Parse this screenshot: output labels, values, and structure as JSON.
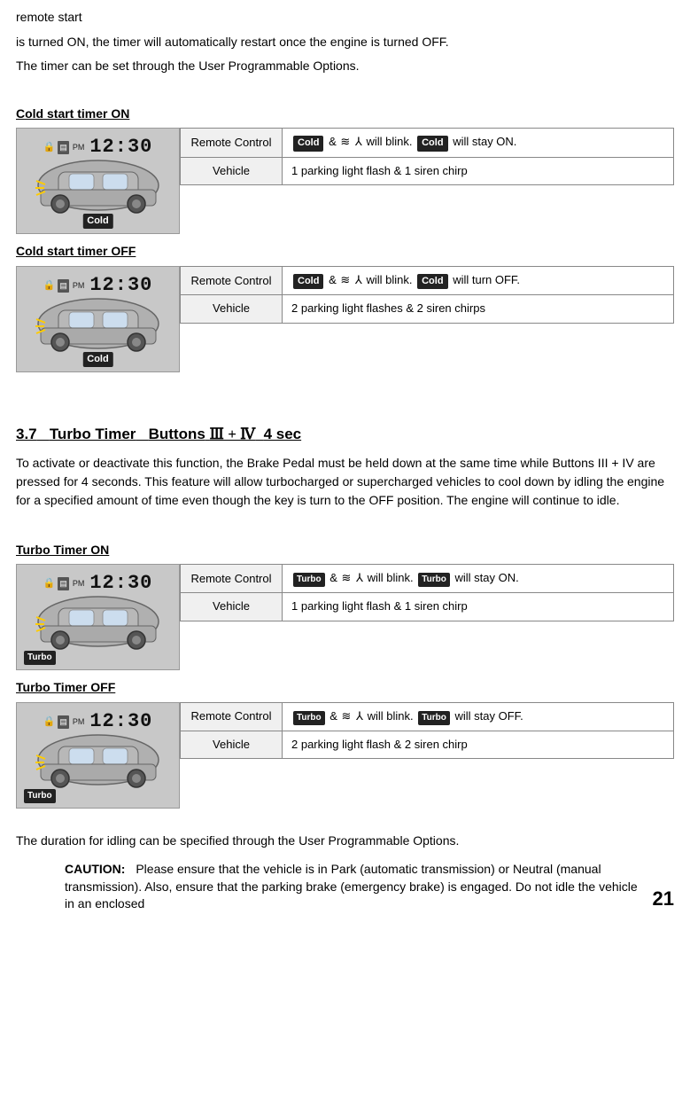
{
  "intro": {
    "line1": "remote start",
    "line2": "is turned ON, the timer will automatically restart once the engine is turned OFF.",
    "line3": "The timer can be set through the User Programmable Options."
  },
  "cold_start_on": {
    "section_title": "Cold start timer ON",
    "remote_label": "Remote Control",
    "vehicle_label": "Vehicle",
    "remote_text_pre": " & ",
    "remote_text_mid": " will blink. ",
    "remote_text_post": " will stay ON.",
    "vehicle_text": "1 parking light flash & 1 siren chirp",
    "badge1": "Cold",
    "badge2": "Cold"
  },
  "cold_start_off": {
    "section_title": "Cold start timer OFF",
    "remote_label": "Remote Control",
    "vehicle_label": "Vehicle",
    "remote_text_pre": " & ",
    "remote_text_mid": " will blink. ",
    "remote_text_post": " will turn OFF.",
    "vehicle_text": "2 parking light flashes & 2 siren chirps",
    "badge1": "Cold",
    "badge2": "Cold"
  },
  "heading_37": {
    "number": "3.7",
    "title": "Turbo Timer",
    "buttons": "Buttons",
    "button_symbols": "III + IV",
    "duration": "4 sec"
  },
  "description": "To activate or deactivate this function, the Brake Pedal must be held down at the same time while Buttons III + IV are pressed for 4 seconds.  This feature will allow turbocharged or supercharged vehicles to cool down by idling the engine for a specified amount of time even though the key is turn to the OFF position. The engine will continue to idle.",
  "turbo_on": {
    "section_title": "Turbo Timer ON",
    "remote_label": "Remote Control",
    "vehicle_label": "Vehicle",
    "remote_text_pre": " & ",
    "remote_text_mid": " will blink. ",
    "remote_text_post": " will stay ON.",
    "vehicle_text": "1 parking light flash & 1 siren chirp",
    "badge1": "Turbo",
    "badge2": "Turbo"
  },
  "turbo_off": {
    "section_title": "Turbo Timer OFF",
    "remote_label": "Remote Control",
    "vehicle_label": "Vehicle",
    "remote_text_pre": " & ",
    "remote_text_mid": " will blink. ",
    "remote_text_post": " will stay OFF.",
    "vehicle_text": "2 parking light flash & 2 siren chirp",
    "badge1": "Turbo",
    "badge2": "Turbo"
  },
  "duration_note": "The duration for idling can be specified through the User Programmable Options.",
  "caution": {
    "label": "CAUTION:",
    "text": "Please ensure that the vehicle is in Park (automatic transmission) or Neutral (manual transmission).  Also, ensure that the parking brake (emergency brake) is engaged.  Do not idle the vehicle in an enclosed"
  },
  "page_number": "21"
}
